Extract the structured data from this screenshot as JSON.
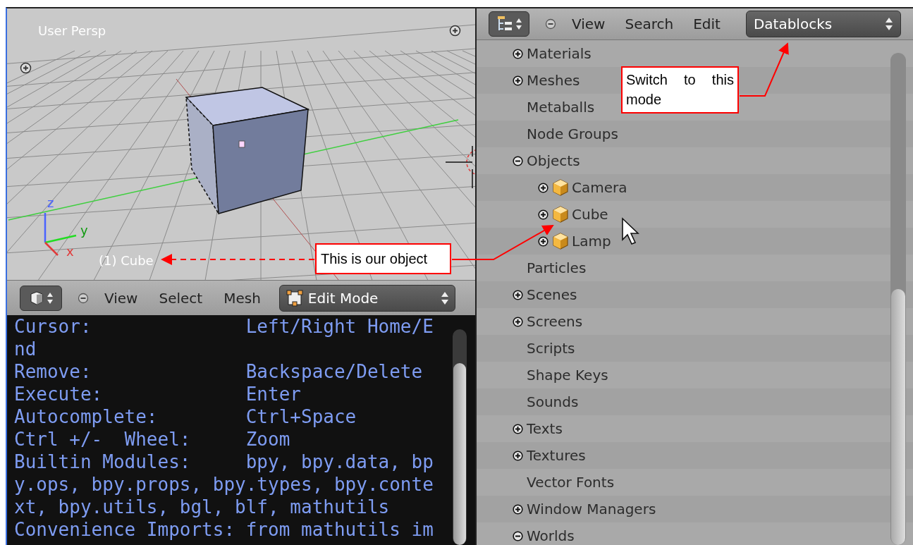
{
  "viewport": {
    "view_label": "User Persp",
    "object_label": "(1) Cube",
    "axes": [
      {
        "label": "z"
      },
      {
        "label": "y"
      },
      {
        "label": "x"
      }
    ]
  },
  "viewport_header": {
    "menus": [
      "View",
      "Select",
      "Mesh"
    ],
    "mode": "Edit Mode"
  },
  "console": {
    "lines": [
      {
        "kind": "pair",
        "key": "Cursor:",
        "value": "Left/Right Home/E"
      },
      {
        "kind": "text",
        "text": "nd"
      },
      {
        "kind": "pair",
        "key": "Remove:",
        "value": "Backspace/Delete"
      },
      {
        "kind": "pair",
        "key": "Execute:",
        "value": "Enter"
      },
      {
        "kind": "pair",
        "key": "Autocomplete:",
        "value": "Ctrl+Space"
      },
      {
        "kind": "pair",
        "key": "Ctrl +/-  Wheel:",
        "value": "Zoom"
      },
      {
        "kind": "pair",
        "key": "Builtin Modules:",
        "value": "bpy, bpy.data, bp"
      },
      {
        "kind": "text",
        "text": "y.ops, bpy.props, bpy.types, bpy.conte"
      },
      {
        "kind": "text",
        "text": "xt, bpy.utils, bgl, blf, mathutils"
      },
      {
        "kind": "text",
        "text": "Convenience Imports: from mathutils im"
      }
    ]
  },
  "outliner_header": {
    "menus": [
      "View",
      "Search",
      "Edit"
    ],
    "display_mode": "Datablocks"
  },
  "outliner": {
    "items": [
      {
        "name": "Materials",
        "expandable": true,
        "expanded": false
      },
      {
        "name": "Meshes",
        "expandable": true,
        "expanded": false
      },
      {
        "name": "Metaballs",
        "expandable": false
      },
      {
        "name": "Node Groups",
        "expandable": false
      },
      {
        "name": "Objects",
        "expandable": true,
        "expanded": true,
        "children": [
          {
            "name": "Camera",
            "expandable": true,
            "expanded": false
          },
          {
            "name": "Cube",
            "expandable": true,
            "expanded": false
          },
          {
            "name": "Lamp",
            "expandable": true,
            "expanded": false
          }
        ]
      },
      {
        "name": "Particles",
        "expandable": false
      },
      {
        "name": "Scenes",
        "expandable": true,
        "expanded": false
      },
      {
        "name": "Screens",
        "expandable": true,
        "expanded": false
      },
      {
        "name": "Scripts",
        "expandable": false
      },
      {
        "name": "Shape Keys",
        "expandable": false
      },
      {
        "name": "Sounds",
        "expandable": false
      },
      {
        "name": "Texts",
        "expandable": true,
        "expanded": false
      },
      {
        "name": "Textures",
        "expandable": true,
        "expanded": false
      },
      {
        "name": "Vector Fonts",
        "expandable": false
      },
      {
        "name": "Window Managers",
        "expandable": true,
        "expanded": false
      },
      {
        "name": "Worlds",
        "expandable": true,
        "expanded": true
      }
    ]
  },
  "annotations": [
    {
      "text": "This is our object"
    },
    {
      "text": "Switch to this mode"
    }
  ]
}
